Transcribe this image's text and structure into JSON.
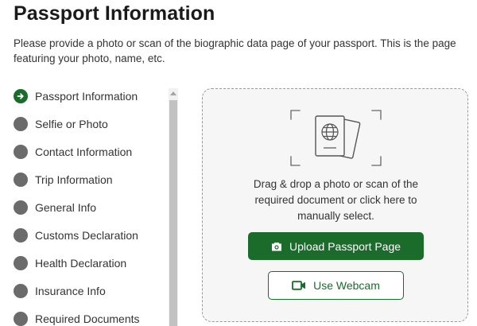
{
  "page": {
    "title": "Passport Information",
    "intro": "Please provide a photo or scan of the biographic data page of your passport. This is the page featuring your photo, name, etc."
  },
  "steps": [
    {
      "label": "Passport Information",
      "icon": "arrow-right-icon",
      "status": "current"
    },
    {
      "label": "Selfie or Photo",
      "status": "pending"
    },
    {
      "label": "Contact Information",
      "status": "pending"
    },
    {
      "label": "Trip Information",
      "status": "pending"
    },
    {
      "label": "General Info",
      "status": "pending"
    },
    {
      "label": "Customs Declaration",
      "status": "pending"
    },
    {
      "label": "Health Declaration",
      "status": "pending"
    },
    {
      "label": "Insurance Info",
      "status": "pending"
    },
    {
      "label": "Required Documents",
      "status": "pending"
    }
  ],
  "upload": {
    "icon": "passport-icon",
    "instructions": "Drag & drop a photo or scan of the required document or click here to manually select.",
    "upload_button": {
      "label": "Upload Passport Page",
      "icon": "camera-icon"
    },
    "webcam_button": {
      "label": "Use Webcam",
      "icon": "video-camera-icon"
    }
  },
  "colors": {
    "accent": "#1b6b2b",
    "step_pending": "#6b6b6b",
    "dropzone_bg": "#f6f6f6",
    "dropzone_border": "#9a9a9a"
  }
}
